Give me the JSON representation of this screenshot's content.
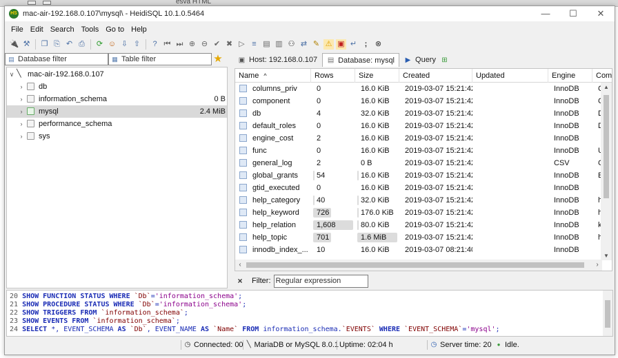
{
  "background_window": {
    "title": "esvä HTML"
  },
  "window": {
    "title": "mac-air-192.168.0.107\\mysql\\ - HeidiSQL 10.1.0.5464",
    "app_icon": "heidisql-icon",
    "controls": {
      "minimize": "—",
      "maximize": "☐",
      "close": "✕"
    }
  },
  "menu": [
    "File",
    "Edit",
    "Search",
    "Tools",
    "Go to",
    "Help"
  ],
  "toolbar": {
    "icons": [
      "connect-icon",
      "disconnect-icon",
      "copy-icon",
      "paste-icon",
      "undo-icon",
      "print-icon",
      "refresh-icon",
      "user-manager-icon",
      "export-icon",
      "import-icon",
      "help-icon",
      "first-icon",
      "last-icon",
      "add-icon",
      "remove-icon",
      "apply-icon",
      "cancel-icon",
      "execute-icon",
      "explain-icon",
      "save-icon",
      "save-as-icon",
      "find-icon",
      "replace-icon",
      "edit-icon",
      "warning-icon",
      "highlight-icon",
      "wrap-icon",
      "semicolon-icon",
      "stop-icon"
    ]
  },
  "filters": {
    "database_placeholder": "Database filter",
    "table_placeholder": "Table filter"
  },
  "tree": {
    "host": "mac-air-192.168.0.107",
    "databases": [
      {
        "name": "db",
        "size": ""
      },
      {
        "name": "information_schema",
        "size": "0 B"
      },
      {
        "name": "mysql",
        "size": "2.4 MiB",
        "selected": true
      },
      {
        "name": "performance_schema",
        "size": ""
      },
      {
        "name": "sys",
        "size": ""
      }
    ]
  },
  "tabs": [
    {
      "label": "Host: 192.168.0.107",
      "icon": "host-icon",
      "active": false
    },
    {
      "label": "Database: mysql",
      "icon": "database-icon",
      "active": true
    },
    {
      "label": "Query",
      "icon": "query-icon",
      "active": false
    }
  ],
  "grid": {
    "columns": [
      "Name",
      "Rows",
      "Size",
      "Created",
      "Updated",
      "Engine",
      "Com"
    ],
    "sort_indicator": "^",
    "rows": [
      {
        "name": "columns_priv",
        "rows": "0",
        "size": "16.0 KiB",
        "created": "2019-03-07 15:21:42",
        "updated": "",
        "engine": "InnoDB",
        "comment": "C",
        "row_fill": 0,
        "size_fill": 0
      },
      {
        "name": "component",
        "rows": "0",
        "size": "16.0 KiB",
        "created": "2019-03-07 15:21:42",
        "updated": "",
        "engine": "InnoDB",
        "comment": "C",
        "row_fill": 0,
        "size_fill": 0
      },
      {
        "name": "db",
        "rows": "4",
        "size": "32.0 KiB",
        "created": "2019-03-07 15:21:42",
        "updated": "",
        "engine": "InnoDB",
        "comment": "D",
        "row_fill": 0,
        "size_fill": 0
      },
      {
        "name": "default_roles",
        "rows": "0",
        "size": "16.0 KiB",
        "created": "2019-03-07 15:21:42",
        "updated": "",
        "engine": "InnoDB",
        "comment": "D",
        "row_fill": 0,
        "size_fill": 0
      },
      {
        "name": "engine_cost",
        "rows": "2",
        "size": "16.0 KiB",
        "created": "2019-03-07 15:21:42",
        "updated": "",
        "engine": "InnoDB",
        "comment": "",
        "row_fill": 0,
        "size_fill": 0
      },
      {
        "name": "func",
        "rows": "0",
        "size": "16.0 KiB",
        "created": "2019-03-07 15:21:42",
        "updated": "",
        "engine": "InnoDB",
        "comment": "U",
        "row_fill": 0,
        "size_fill": 0
      },
      {
        "name": "general_log",
        "rows": "2",
        "size": "0 B",
        "created": "2019-03-07 15:21:42",
        "updated": "",
        "engine": "CSV",
        "comment": "G",
        "row_fill": 0,
        "size_fill": 0
      },
      {
        "name": "global_grants",
        "rows": "54",
        "size": "16.0 KiB",
        "created": "2019-03-07 15:21:42",
        "updated": "",
        "engine": "InnoDB",
        "comment": "E",
        "row_fill": 0.03,
        "size_fill": 0.02
      },
      {
        "name": "gtid_executed",
        "rows": "0",
        "size": "16.0 KiB",
        "created": "2019-03-07 15:21:42",
        "updated": "",
        "engine": "InnoDB",
        "comment": "",
        "row_fill": 0,
        "size_fill": 0
      },
      {
        "name": "help_category",
        "rows": "40",
        "size": "32.0 KiB",
        "created": "2019-03-07 15:21:42",
        "updated": "",
        "engine": "InnoDB",
        "comment": "h",
        "row_fill": 0.02,
        "size_fill": 0.02
      },
      {
        "name": "help_keyword",
        "rows": "726",
        "size": "176.0 KiB",
        "created": "2019-03-07 15:21:42",
        "updated": "",
        "engine": "InnoDB",
        "comment": "h",
        "row_fill": 0.45,
        "size_fill": 0.04
      },
      {
        "name": "help_relation",
        "rows": "1,608",
        "size": "80.0 KiB",
        "created": "2019-03-07 15:21:42",
        "updated": "",
        "engine": "InnoDB",
        "comment": "k",
        "row_fill": 1.0,
        "size_fill": 0.02
      },
      {
        "name": "help_topic",
        "rows": "701",
        "size": "1.6 MiB",
        "created": "2019-03-07 15:21:42",
        "updated": "",
        "engine": "InnoDB",
        "comment": "h",
        "row_fill": 0.44,
        "size_fill": 1.0
      },
      {
        "name": "innodb_index_...",
        "rows": "10",
        "size": "16.0 KiB",
        "created": "2019-03-07 08:21:40",
        "updated": "",
        "engine": "InnoDB",
        "comment": "",
        "row_fill": 0,
        "size_fill": 0
      }
    ]
  },
  "filter": {
    "close_label": "×",
    "label": "Filter:",
    "placeholder": "Regular expression"
  },
  "sql_log": [
    [
      [
        "ln",
        "20 "
      ],
      [
        "kw",
        "SHOW FUNCTION STATUS WHERE "
      ],
      [
        "id",
        "`Db`"
      ],
      [
        "pl",
        "="
      ],
      [
        "str",
        "'information_schema'"
      ],
      [
        "pl",
        ";"
      ]
    ],
    [
      [
        "ln",
        "21 "
      ],
      [
        "kw",
        "SHOW PROCEDURE STATUS WHERE "
      ],
      [
        "id",
        "`Db`"
      ],
      [
        "pl",
        "="
      ],
      [
        "str",
        "'information_schema'"
      ],
      [
        "pl",
        ";"
      ]
    ],
    [
      [
        "ln",
        "22 "
      ],
      [
        "kw",
        "SHOW TRIGGERS FROM "
      ],
      [
        "id",
        "`information_schema`"
      ],
      [
        "pl",
        ";"
      ]
    ],
    [
      [
        "ln",
        "23 "
      ],
      [
        "kw",
        "SHOW EVENTS FROM "
      ],
      [
        "id",
        "`information_schema`"
      ],
      [
        "pl",
        ";"
      ]
    ],
    [
      [
        "ln",
        "24 "
      ],
      [
        "kw",
        "SELECT "
      ],
      [
        "pl",
        "*, EVENT_SCHEMA "
      ],
      [
        "kw",
        "AS "
      ],
      [
        "id",
        "`Db`"
      ],
      [
        "pl",
        ", EVENT_NAME "
      ],
      [
        "kw",
        "AS "
      ],
      [
        "id",
        "`Name`"
      ],
      [
        "pl",
        " "
      ],
      [
        "kw",
        "FROM "
      ],
      [
        "pl",
        "information_schema."
      ],
      [
        "id",
        "`EVENTS`"
      ],
      [
        "pl",
        " "
      ],
      [
        "kw",
        "WHERE "
      ],
      [
        "id",
        "`EVENT_SCHEMA`"
      ],
      [
        "pl",
        "="
      ],
      [
        "str",
        "'mysql'"
      ],
      [
        "pl",
        ";"
      ]
    ]
  ],
  "status": {
    "connected": "Connected: 00",
    "server": "MariaDB or MySQL 8.0.1",
    "uptime": "Uptime: 02:04 h",
    "server_time": "Server time: 20",
    "state": "Idle."
  }
}
